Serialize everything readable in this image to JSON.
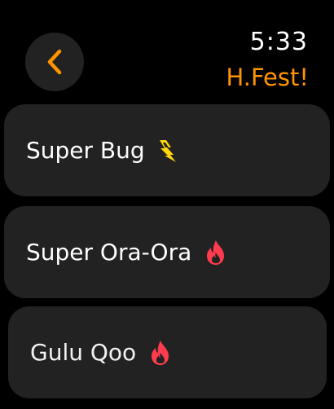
{
  "header": {
    "time": "5:33",
    "title": "H.Fest!",
    "back_icon": "chevron-left-icon"
  },
  "colors": {
    "accent": "#ff9500",
    "row_background": "#222222",
    "lightning": "#ffd60a",
    "flame": "#ff3b4e"
  },
  "items": [
    {
      "label": "Super Bug",
      "icon": "lightning-icon"
    },
    {
      "label": "Super Ora-Ora",
      "icon": "flame-icon"
    },
    {
      "label": "Gulu Qoo",
      "icon": "flame-icon"
    }
  ]
}
